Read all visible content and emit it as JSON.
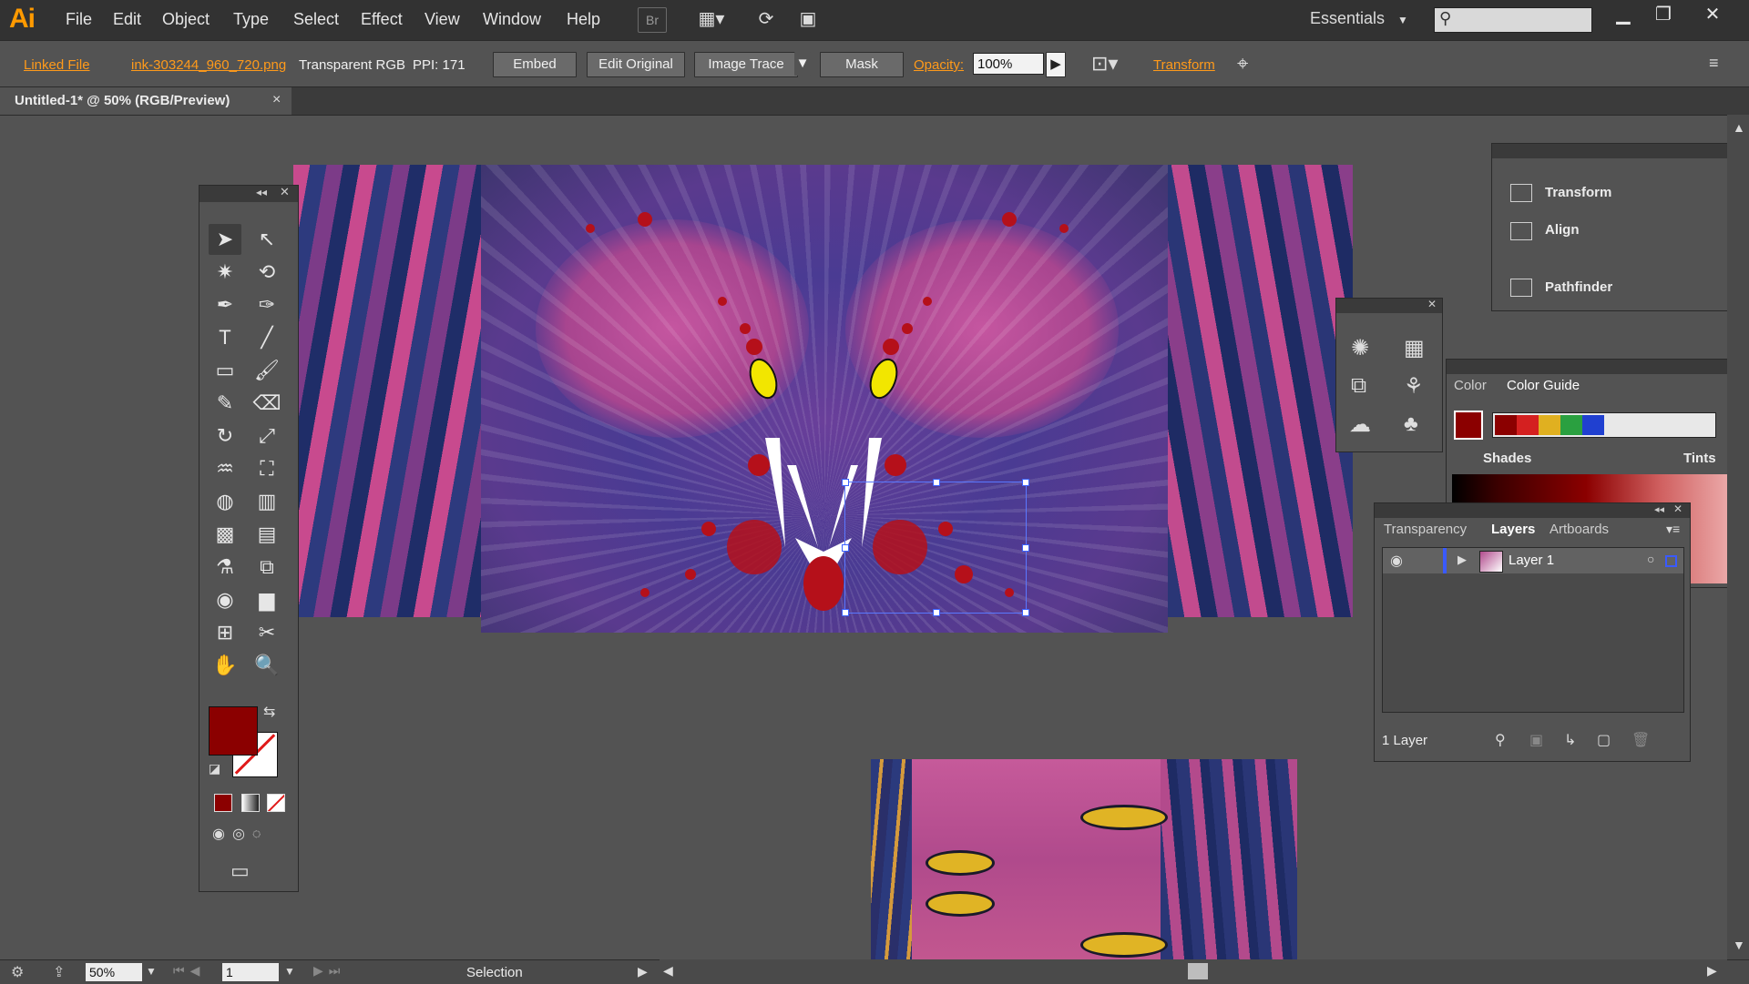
{
  "app": {
    "logo": "Ai"
  },
  "menu": [
    "File",
    "Edit",
    "Object",
    "Type",
    "Select",
    "Effect",
    "View",
    "Window",
    "Help"
  ],
  "menubar_icons": {
    "bridge": "Br"
  },
  "workspace": {
    "label": "Essentials"
  },
  "controlbar": {
    "linked_file": "Linked File",
    "file_name": "ink-303244_960_720.png",
    "color_mode": "Transparent RGB",
    "ppi": "PPI: 171",
    "embed": "Embed",
    "edit_original": "Edit Original",
    "image_trace": "Image Trace",
    "mask": "Mask",
    "opacity_label": "Opacity:",
    "opacity_value": "100%",
    "transform": "Transform"
  },
  "document_tab": {
    "title": "Untitled-1* @ 50% (RGB/Preview)",
    "close": "×"
  },
  "dock_panel": {
    "items": [
      "Transform",
      "Align",
      "Pathfinder"
    ]
  },
  "color_panel": {
    "tabs": [
      "Color",
      "Color Guide"
    ],
    "shades_label": "Shades",
    "tints_label": "Tints",
    "harmony_colors": [
      "#8b0000",
      "#d42020",
      "#e0b020",
      "#2aa040",
      "#2040d0"
    ]
  },
  "layers_panel": {
    "tabs": [
      "Transparency",
      "Layers",
      "Artboards"
    ],
    "layer_name": "Layer 1",
    "count": "1 Layer"
  },
  "statusbar": {
    "zoom": "50%",
    "page": "1",
    "tool": "Selection"
  },
  "colors": {
    "fill": "#8b0000",
    "stroke": "none",
    "accent": "#ff9a00"
  }
}
